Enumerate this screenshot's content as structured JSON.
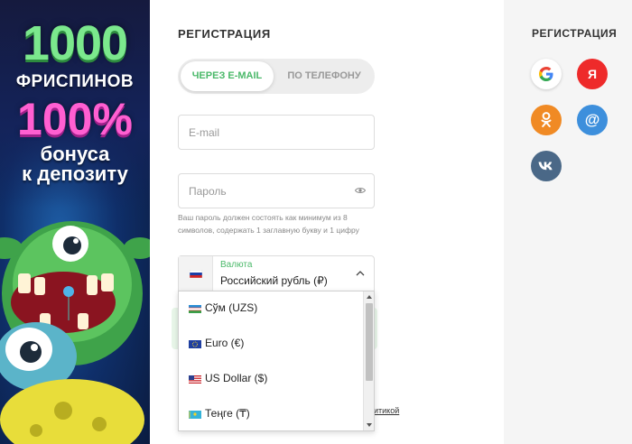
{
  "banner": {
    "line1": "1000",
    "line2": "ФРИСПИНОВ",
    "line3": "100%",
    "line4": "бонуса",
    "line5": "к депозиту"
  },
  "form": {
    "title": "РЕГИСТРАЦИЯ",
    "tabs": [
      {
        "label": "ЧЕРЕЗ E-MAIL",
        "active": true
      },
      {
        "label": "ПО ТЕЛЕФОНУ",
        "active": false
      }
    ],
    "email_placeholder": "E-mail",
    "password_placeholder": "Пароль",
    "password_hint": "Ваш пароль должен состоять как минимум из 8 символов, содержать 1 заглавную букву и 1 цифру",
    "currency": {
      "label": "Валюта",
      "selected": "Российский рубль (₽)",
      "options": [
        {
          "label": "Сўм (UZS)",
          "flag": "uz-flag-icon"
        },
        {
          "label": "Euro (€)",
          "flag": "eu-flag-icon"
        },
        {
          "label": "US Dollar ($)",
          "flag": "us-flag-icon"
        },
        {
          "label": "Теңге (₸)",
          "flag": "kz-flag-icon"
        }
      ]
    },
    "partial_link": "итикой"
  },
  "social": {
    "title": "РЕГИСТРАЦИЯ",
    "buttons": [
      {
        "name": "google",
        "icon": "google-icon",
        "color": "#ffffff"
      },
      {
        "name": "yandex",
        "icon": "yandex-icon",
        "glyph": "Я",
        "color": "#ee2a2a"
      },
      {
        "name": "odnoklassniki",
        "icon": "odnoklassniki-icon",
        "color": "#f08a24"
      },
      {
        "name": "mail",
        "icon": "mail-at-icon",
        "glyph": "@",
        "color": "#3d8fdc"
      },
      {
        "name": "vk",
        "icon": "vk-icon",
        "color": "#4a6887"
      }
    ]
  },
  "colors": {
    "accent": "#4bb96a",
    "side_bg": "#f5f5f5"
  }
}
